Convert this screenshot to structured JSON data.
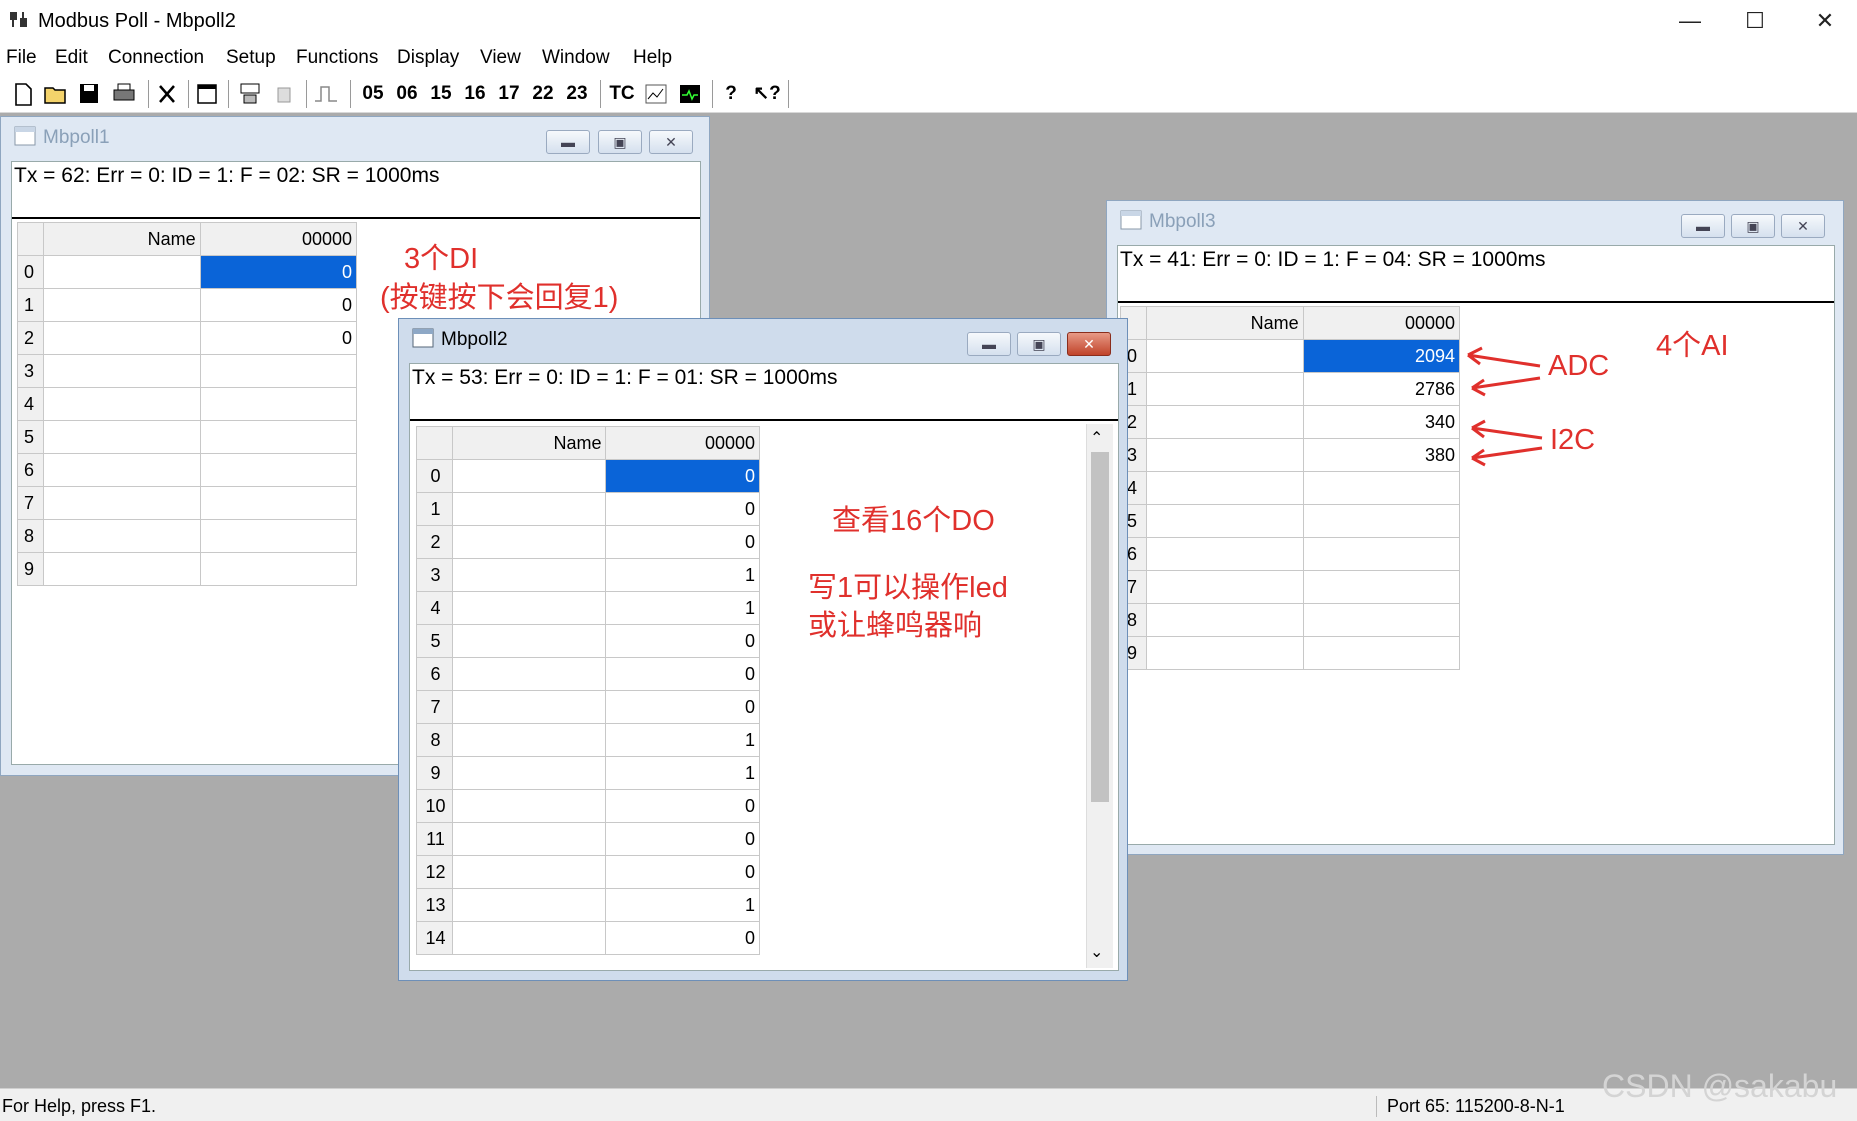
{
  "app": {
    "title": "Modbus Poll - Mbpoll2"
  },
  "menu": [
    "File",
    "Edit",
    "Connection",
    "Setup",
    "Functions",
    "Display",
    "View",
    "Window",
    "Help"
  ],
  "toolbar": {
    "function_codes": [
      "05",
      "06",
      "15",
      "16",
      "17",
      "22",
      "23"
    ],
    "tc_label": "TC"
  },
  "colors": {
    "selection": "#0a64d8",
    "annotation": "#e0302c",
    "mdi_background": "#ababab"
  },
  "windows": {
    "mbpoll1": {
      "title": "Mbpoll1",
      "status": "Tx = 62: Err = 0: ID = 1: F = 02: SR = 1000ms",
      "col_name": "Name",
      "col_addr": "00000",
      "rows": [
        {
          "idx": "0",
          "val": "0"
        },
        {
          "idx": "1",
          "val": "0"
        },
        {
          "idx": "2",
          "val": "0"
        },
        {
          "idx": "3",
          "val": ""
        },
        {
          "idx": "4",
          "val": ""
        },
        {
          "idx": "5",
          "val": ""
        },
        {
          "idx": "6",
          "val": ""
        },
        {
          "idx": "7",
          "val": ""
        },
        {
          "idx": "8",
          "val": ""
        },
        {
          "idx": "9",
          "val": ""
        }
      ]
    },
    "mbpoll2": {
      "title": "Mbpoll2",
      "status": "Tx = 53: Err = 0: ID = 1: F = 01: SR = 1000ms",
      "col_name": "Name",
      "col_addr": "00000",
      "rows": [
        {
          "idx": "0",
          "val": "0"
        },
        {
          "idx": "1",
          "val": "0"
        },
        {
          "idx": "2",
          "val": "0"
        },
        {
          "idx": "3",
          "val": "1"
        },
        {
          "idx": "4",
          "val": "1"
        },
        {
          "idx": "5",
          "val": "0"
        },
        {
          "idx": "6",
          "val": "0"
        },
        {
          "idx": "7",
          "val": "0"
        },
        {
          "idx": "8",
          "val": "1"
        },
        {
          "idx": "9",
          "val": "1"
        },
        {
          "idx": "10",
          "val": "0"
        },
        {
          "idx": "11",
          "val": "0"
        },
        {
          "idx": "12",
          "val": "0"
        },
        {
          "idx": "13",
          "val": "1"
        },
        {
          "idx": "14",
          "val": "0"
        }
      ]
    },
    "mbpoll3": {
      "title": "Mbpoll3",
      "status": "Tx = 41: Err = 0: ID = 1: F = 04: SR = 1000ms",
      "col_name": "Name",
      "col_addr": "00000",
      "rows": [
        {
          "idx": "0",
          "val": "2094"
        },
        {
          "idx": "1",
          "val": "2786"
        },
        {
          "idx": "2",
          "val": "340"
        },
        {
          "idx": "3",
          "val": "380"
        },
        {
          "idx": "4",
          "val": ""
        },
        {
          "idx": "5",
          "val": ""
        },
        {
          "idx": "6",
          "val": ""
        },
        {
          "idx": "7",
          "val": ""
        },
        {
          "idx": "8",
          "val": ""
        },
        {
          "idx": "9",
          "val": ""
        }
      ]
    }
  },
  "annotations": {
    "di_count": "3个DI",
    "di_note": "(按键按下会回复1)",
    "do_count": "查看16个DO",
    "do_note_1": "写1可以操作led",
    "do_note_2": "或让蜂鸣器响",
    "ai_count": "4个AI",
    "adc": "ADC",
    "i2c": "I2C"
  },
  "status_bar": {
    "help": "For Help, press F1.",
    "port": "Port 65: 115200-8-N-1"
  },
  "watermark": "CSDN @sakabu"
}
